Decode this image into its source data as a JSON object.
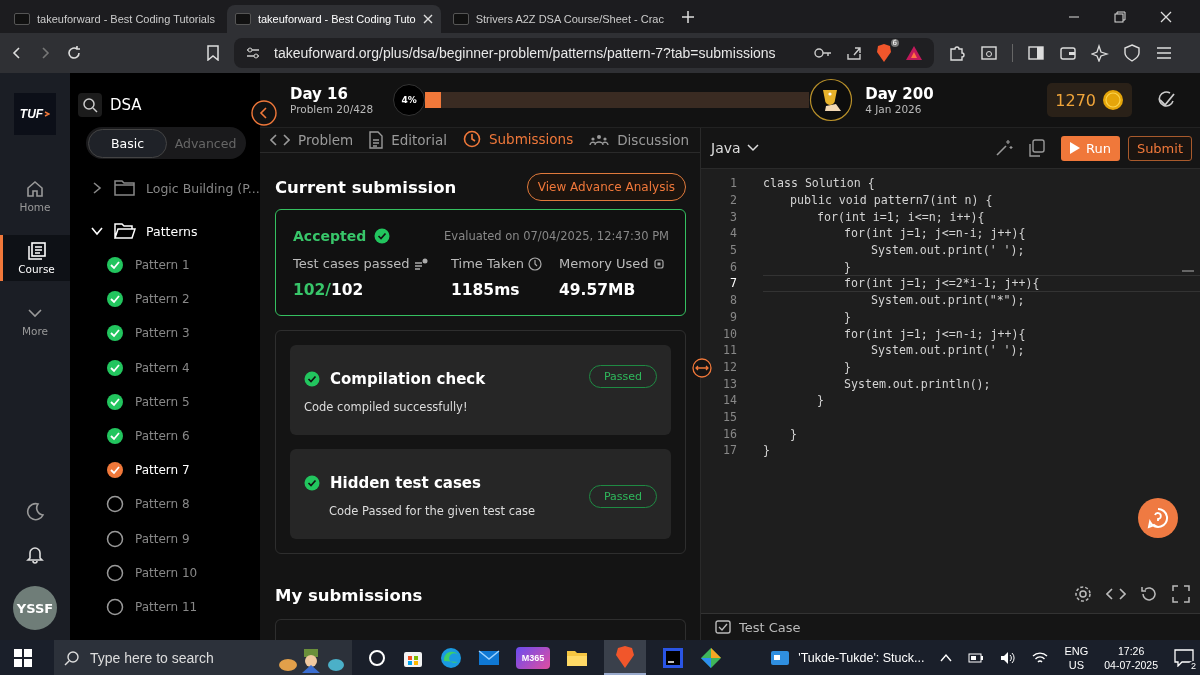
{
  "browser": {
    "tabs": [
      {
        "title": "takeuforward - Best Coding Tutorials",
        "selected": false
      },
      {
        "title": "takeuforward - Best Coding Tuto",
        "selected": true
      },
      {
        "title": "Strivers A2Z DSA Course/Sheet - Crac",
        "selected": false
      }
    ],
    "url": "takeuforward.org/plus/dsa/beginner-problem/patterns/pattern-7?tab=submissions",
    "shield_count": "6"
  },
  "rail": {
    "logo": "TUF",
    "items": [
      {
        "label": "Home",
        "kind": "home",
        "selected": false
      },
      {
        "label": "Course",
        "kind": "course",
        "selected": true
      },
      {
        "label": "More",
        "kind": "more",
        "selected": false
      }
    ],
    "avatar": "YSSF"
  },
  "sidebar": {
    "title": "DSA",
    "segments": [
      {
        "label": "Basic",
        "selected": true
      },
      {
        "label": "Advanced",
        "selected": false
      }
    ],
    "folders": [
      {
        "label": "Logic Building (P...",
        "expanded": false
      },
      {
        "label": "Patterns",
        "expanded": true,
        "children": [
          {
            "label": "Pattern 1",
            "solved": true,
            "selected": false
          },
          {
            "label": "Pattern 2",
            "solved": true,
            "selected": false
          },
          {
            "label": "Pattern 3",
            "solved": true,
            "selected": false
          },
          {
            "label": "Pattern 4",
            "solved": true,
            "selected": false
          },
          {
            "label": "Pattern 5",
            "solved": true,
            "selected": false
          },
          {
            "label": "Pattern 6",
            "solved": true,
            "selected": false
          },
          {
            "label": "Pattern 7",
            "solved": true,
            "selected": true
          },
          {
            "label": "Pattern 8",
            "solved": false,
            "selected": false
          },
          {
            "label": "Pattern 9",
            "solved": false,
            "selected": false
          },
          {
            "label": "Pattern 10",
            "solved": false,
            "selected": false
          },
          {
            "label": "Pattern 11",
            "solved": false,
            "selected": false
          }
        ]
      }
    ]
  },
  "progress": {
    "day": "Day 16",
    "problem": "Problem 20/428",
    "percent": "4%",
    "level": 0.04,
    "goal_day": "Day 200",
    "goal_date": "4 Jan 2026",
    "coins": "1270"
  },
  "tabs": [
    {
      "label": "Problem",
      "kind": "code",
      "selected": false
    },
    {
      "label": "Editorial",
      "kind": "doc",
      "selected": false
    },
    {
      "label": "Submissions",
      "kind": "clock",
      "selected": true
    },
    {
      "label": "Discussion",
      "kind": "people",
      "selected": false
    }
  ],
  "current": {
    "heading": "Current submission",
    "analysis_button": "View Advance Analysis",
    "status": "Accepted",
    "evaluated": "Evaluated on 07/04/2025, 12:47:30 PM",
    "stats": [
      {
        "label": "Test cases passed",
        "kind": "tests",
        "highlight": "102/",
        "value": "102"
      },
      {
        "label": "Time Taken",
        "kind": "time",
        "value": "1185ms"
      },
      {
        "label": "Memory Used",
        "kind": "memory",
        "value": "49.57MB"
      }
    ],
    "checks": [
      {
        "title": "Compilation check",
        "detail": "Code compiled successfully!",
        "badge": "Passed",
        "indented": false
      },
      {
        "title": "Hidden test cases",
        "detail": "Code Passed for the given test case",
        "badge": "Passed",
        "indented": true
      }
    ]
  },
  "my_submissions": {
    "heading": "My submissions"
  },
  "editor": {
    "language": "Java",
    "run": "Run",
    "submit": "Submit",
    "test_case": "Test Case",
    "lines": [
      {
        "n": "1",
        "text": "class Solution {",
        "cursor": false,
        "children": [
          {
            "n": "2",
            "text": "public void pattern7(int n) {",
            "cursor": false,
            "children": [
              {
                "n": "3",
                "text": "for(int i=1; i<=n; i++){",
                "cursor": false,
                "children": [
                  {
                    "n": "4",
                    "text": "for(int j=1; j<=n-i; j++){",
                    "cursor": false,
                    "children": [
                      {
                        "n": "5",
                        "text": "System.out.print(' ');",
                        "cursor": false
                      }
                    ]
                  },
                  {
                    "n": "6",
                    "text": "}",
                    "cursor": false
                  },
                  {
                    "n": "7",
                    "text": "for(int j=1; j<=2*i-1; j++){",
                    "cursor": true,
                    "children": [
                      {
                        "n": "8",
                        "text": "System.out.print(\"*\");",
                        "cursor": false
                      }
                    ]
                  },
                  {
                    "n": "9",
                    "text": "}",
                    "cursor": false
                  },
                  {
                    "n": "10",
                    "text": "for(int j=1; j<=n-i; j++){",
                    "cursor": false,
                    "children": [
                      {
                        "n": "11",
                        "text": "System.out.print(' ');",
                        "cursor": false
                      }
                    ]
                  },
                  {
                    "n": "12",
                    "text": "}",
                    "cursor": false
                  },
                  {
                    "n": "13",
                    "text": "System.out.println();",
                    "cursor": false
                  }
                ]
              },
              {
                "n": "14",
                "text": "}",
                "cursor": false
              },
              {
                "n": "15",
                "cursor": false
              }
            ]
          },
          {
            "n": "16",
            "text": "}",
            "cursor": false
          }
        ]
      },
      {
        "n": "17",
        "text": "}",
        "cursor": false
      }
    ]
  },
  "taskbar": {
    "search_placeholder": "Type here to search",
    "m365": "M365",
    "news": "'Tukde-Tukde': Stuck...",
    "lang": "ENG",
    "region": "US",
    "time": "17:26",
    "date": "04-07-2025",
    "notifications": "2"
  }
}
